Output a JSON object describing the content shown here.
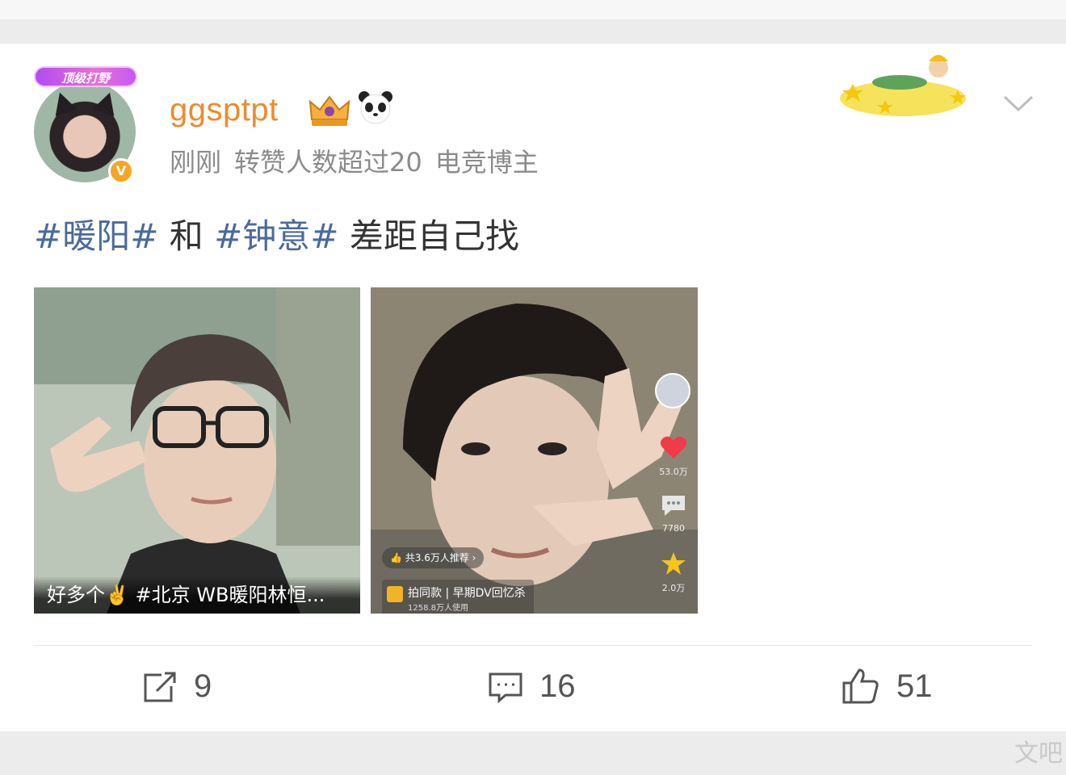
{
  "post": {
    "author": {
      "username": "ggsptpt",
      "badge_label": "顶级打野",
      "verified_mark": "V",
      "icons": [
        "crown-icon",
        "panda-icon"
      ]
    },
    "meta": {
      "time": "刚刚",
      "repost_note": "转赞人数超过20",
      "role": "电竞博主"
    },
    "text": {
      "topic1": "#暖阳#",
      "joiner": " 和 ",
      "topic2": "#钟意#",
      "rest": " 差距自己找"
    },
    "images": [
      {
        "caption": "好多个✌️ #北京 WB暖阳林恒..."
      },
      {
        "recommend_chip": "👍 共3.6万人推荐 ›",
        "template_title": "拍同款 | 早期DV回忆杀",
        "template_sub": "1258.8万人使用",
        "likes": "53.0万",
        "comments": "7780",
        "favorites": "2.0万"
      }
    ],
    "actions": {
      "repost_count": "9",
      "comment_count": "16",
      "like_count": "51"
    }
  },
  "next_post_fragment": "文吧",
  "colors": {
    "username": "#f08a2c",
    "topic": "#4a6a9c",
    "meta": "#8b8b8b"
  }
}
